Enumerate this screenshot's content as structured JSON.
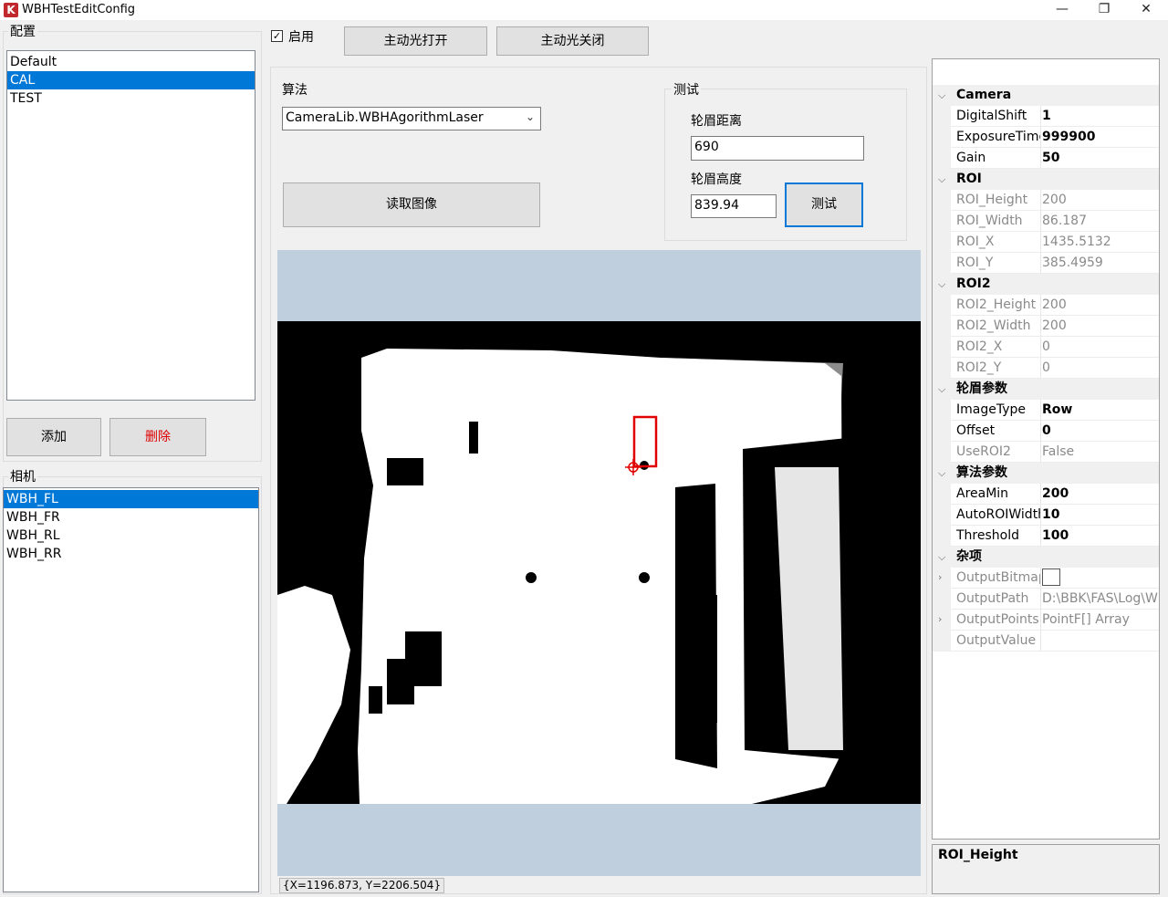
{
  "window": {
    "title": "WBHTestEditConfig",
    "icon": "app-logo-icon"
  },
  "config_group": {
    "title": "配置",
    "items": [
      "Default",
      "CAL",
      "TEST"
    ],
    "selected_index": 1,
    "add_label": "添加",
    "delete_label": "删除",
    "delete_color": "#e00000"
  },
  "camera_group": {
    "title": "相机",
    "items": [
      "WBH_FL",
      "WBH_FR",
      "WBH_RL",
      "WBH_RR"
    ],
    "selected_index": 0
  },
  "toolbar": {
    "enable_label": "启用",
    "enable_checked": true,
    "light_on_label": "主动光打开",
    "light_off_label": "主动光关闭"
  },
  "algorithm": {
    "label": "算法",
    "selected": "CameraLib.WBHAgorithmLaser",
    "read_image_label": "读取图像"
  },
  "test_group": {
    "title": "测试",
    "distance_label": "轮眉距离",
    "distance_value": "690",
    "height_label": "轮眉高度",
    "height_value": "839.94",
    "test_button_label": "测试"
  },
  "viewer": {
    "status_text": "{X=1196.873, Y=2206.504}",
    "roi_color": "#e00000",
    "background_color": "#c0cfdd"
  },
  "property_grid": {
    "toolbar_icons": [
      "categorized-icon",
      "alphabetical-sort-icon",
      "property-pages-icon"
    ],
    "categories": [
      {
        "label": "Camera",
        "rows": [
          {
            "name": "DigitalShift",
            "value": "1",
            "readonly": false
          },
          {
            "name": "ExposureTime",
            "value": "999900",
            "readonly": false
          },
          {
            "name": "Gain",
            "value": "50",
            "readonly": false
          }
        ]
      },
      {
        "label": "ROI",
        "rows": [
          {
            "name": "ROI_Height",
            "value": "200",
            "readonly": true
          },
          {
            "name": "ROI_Width",
            "value": "86.187",
            "readonly": true
          },
          {
            "name": "ROI_X",
            "value": "1435.5132",
            "readonly": true
          },
          {
            "name": "ROI_Y",
            "value": "385.4959",
            "readonly": true
          }
        ]
      },
      {
        "label": "ROI2",
        "rows": [
          {
            "name": "ROI2_Height",
            "value": "200",
            "readonly": true
          },
          {
            "name": "ROI2_Width",
            "value": "200",
            "readonly": true
          },
          {
            "name": "ROI2_X",
            "value": "0",
            "readonly": true
          },
          {
            "name": "ROI2_Y",
            "value": "0",
            "readonly": true
          }
        ]
      },
      {
        "label": "轮眉参数",
        "rows": [
          {
            "name": "ImageType",
            "value": "Row",
            "readonly": false
          },
          {
            "name": "Offset",
            "value": "0",
            "readonly": false
          },
          {
            "name": "UseROI2",
            "value": "False",
            "readonly": true
          }
        ]
      },
      {
        "label": "算法参数",
        "rows": [
          {
            "name": "AreaMin",
            "value": "200",
            "readonly": false
          },
          {
            "name": "AutoROIWidth",
            "value": "10",
            "readonly": false
          },
          {
            "name": "Threshold",
            "value": "100",
            "readonly": false
          }
        ]
      },
      {
        "label": "杂项",
        "rows": [
          {
            "name": "OutputBitmap",
            "value": "",
            "readonly": true,
            "expandable": true,
            "swatch": true
          },
          {
            "name": "OutputPath",
            "value": "D:\\BBK\\FAS\\Log\\W",
            "readonly": true
          },
          {
            "name": "OutputPoints",
            "value": "PointF[] Array",
            "readonly": true,
            "expandable": true
          },
          {
            "name": "OutputValue",
            "value": "",
            "readonly": true
          }
        ]
      }
    ],
    "description_title": "ROI_Height"
  }
}
